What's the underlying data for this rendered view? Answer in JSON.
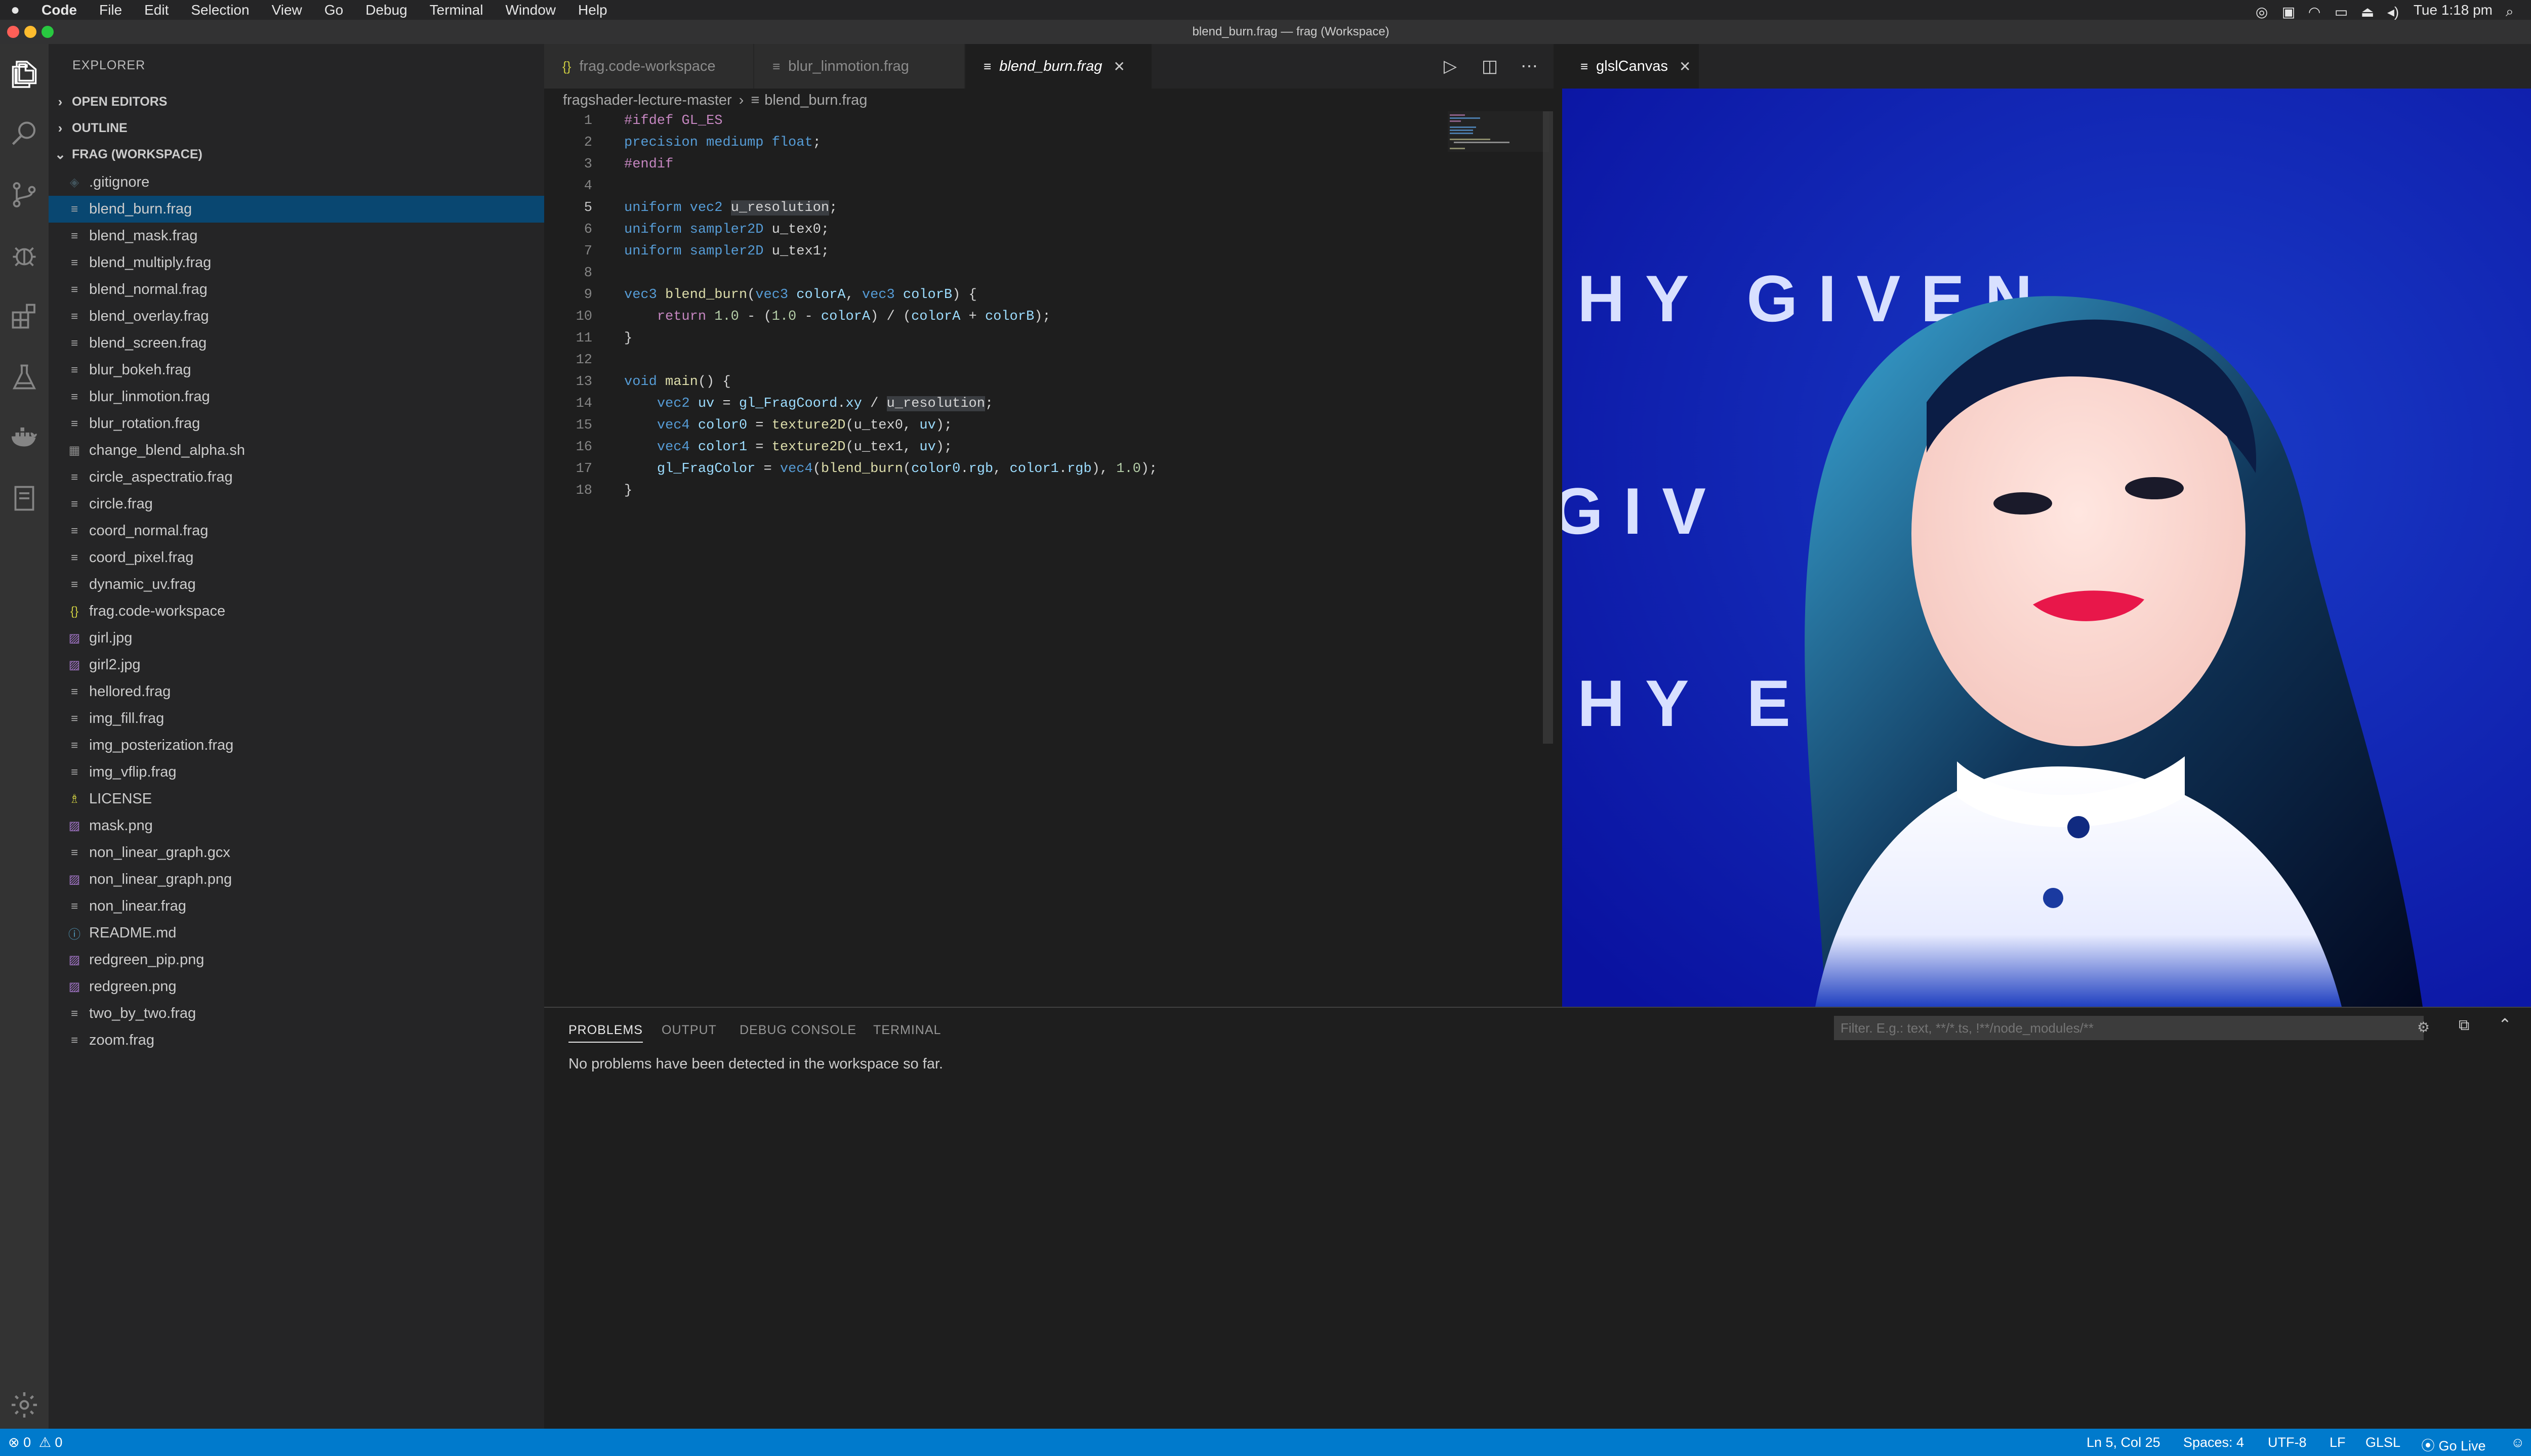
{
  "menubar": {
    "apple": "",
    "app": "Code",
    "items": [
      "File",
      "Edit",
      "Selection",
      "View",
      "Go",
      "Debug",
      "Terminal",
      "Window",
      "Help"
    ],
    "clock": "Tue 1:18 pm"
  },
  "window": {
    "title": "blend_burn.frag — frag (Workspace)"
  },
  "sidebar": {
    "header": "EXPLORER",
    "sections": {
      "open_editors": "OPEN EDITORS",
      "outline": "OUTLINE",
      "workspace": "FRAG (WORKSPACE)"
    },
    "files": [
      {
        "name": ".gitignore",
        "icon": "◈"
      },
      {
        "name": "blend_burn.frag",
        "icon": "≡",
        "selected": true
      },
      {
        "name": "blend_mask.frag",
        "icon": "≡"
      },
      {
        "name": "blend_multiply.frag",
        "icon": "≡"
      },
      {
        "name": "blend_normal.frag",
        "icon": "≡"
      },
      {
        "name": "blend_overlay.frag",
        "icon": "≡"
      },
      {
        "name": "blend_screen.frag",
        "icon": "≡"
      },
      {
        "name": "blur_bokeh.frag",
        "icon": "≡"
      },
      {
        "name": "blur_linmotion.frag",
        "icon": "≡"
      },
      {
        "name": "blur_rotation.frag",
        "icon": "≡"
      },
      {
        "name": "change_blend_alpha.sh",
        "icon": "▦"
      },
      {
        "name": "circle_aspectratio.frag",
        "icon": "≡"
      },
      {
        "name": "circle.frag",
        "icon": "≡"
      },
      {
        "name": "coord_normal.frag",
        "icon": "≡"
      },
      {
        "name": "coord_pixel.frag",
        "icon": "≡"
      },
      {
        "name": "dynamic_uv.frag",
        "icon": "≡"
      },
      {
        "name": "frag.code-workspace",
        "icon": "{}"
      },
      {
        "name": "girl.jpg",
        "icon": "▨"
      },
      {
        "name": "girl2.jpg",
        "icon": "▨"
      },
      {
        "name": "hellored.frag",
        "icon": "≡"
      },
      {
        "name": "img_fill.frag",
        "icon": "≡"
      },
      {
        "name": "img_posterization.frag",
        "icon": "≡"
      },
      {
        "name": "img_vflip.frag",
        "icon": "≡"
      },
      {
        "name": "LICENSE",
        "icon": "♗"
      },
      {
        "name": "mask.png",
        "icon": "▨"
      },
      {
        "name": "non_linear_graph.gcx",
        "icon": "≡"
      },
      {
        "name": "non_linear_graph.png",
        "icon": "▨"
      },
      {
        "name": "non_linear.frag",
        "icon": "≡"
      },
      {
        "name": "README.md",
        "icon": "ⓘ"
      },
      {
        "name": "redgreen_pip.png",
        "icon": "▨"
      },
      {
        "name": "redgreen.png",
        "icon": "▨"
      },
      {
        "name": "two_by_two.frag",
        "icon": "≡"
      },
      {
        "name": "zoom.frag",
        "icon": "≡"
      }
    ]
  },
  "editor": {
    "tabs": [
      {
        "label": "frag.code-workspace",
        "icon": "{}"
      },
      {
        "label": "blur_linmotion.frag",
        "icon": "≡"
      },
      {
        "label": "blend_burn.frag",
        "icon": "≡",
        "active": true
      }
    ],
    "breadcrumb": {
      "folder": "fragshader-lecture-master",
      "file": "blend_burn.frag"
    },
    "line_numbers": [
      "1",
      "2",
      "3",
      "4",
      "5",
      "6",
      "7",
      "8",
      "9",
      "10",
      "11",
      "12",
      "13",
      "14",
      "15",
      "16",
      "17",
      "18"
    ],
    "current_line": 5
  },
  "canvas_panel": {
    "tab_label": "glslCanvas",
    "banner_text_top": "HY   GIVEN",
    "banner_text_mid": "GIV",
    "banner_text_bottom": "HY      EN"
  },
  "panel": {
    "tabs": [
      "PROBLEMS",
      "OUTPUT",
      "DEBUG CONSOLE",
      "TERMINAL"
    ],
    "filter_placeholder": "Filter. E.g.: text, **/*.ts, !**/node_modules/**",
    "message": "No problems have been detected in the workspace so far."
  },
  "status": {
    "errors": "0",
    "warnings": "0",
    "position": "Ln 5, Col 25",
    "spaces": "Spaces: 4",
    "encoding": "UTF-8",
    "eol": "LF",
    "language": "GLSL",
    "golive": "Go Live"
  },
  "colors": {
    "accent": "#007acc",
    "selection": "#094771",
    "sidebar": "#252526",
    "editor_bg": "#1e1e1e"
  }
}
